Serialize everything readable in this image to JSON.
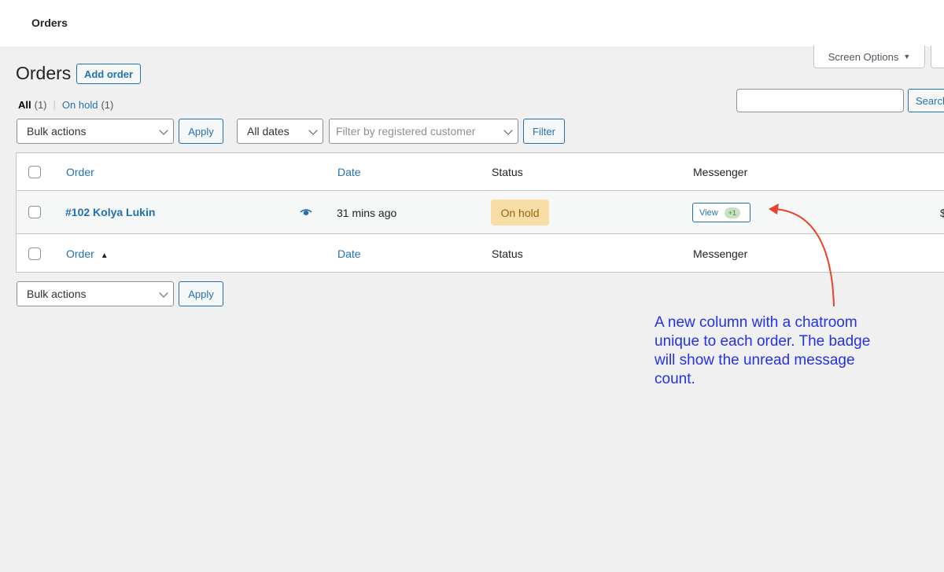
{
  "topbar": {
    "title": "Orders"
  },
  "screen_options": {
    "label": "Screen Options",
    "caret": "▼"
  },
  "page": {
    "title": "Orders",
    "add_button": "Add order"
  },
  "views": {
    "all_label": "All",
    "all_count": "(1)",
    "separator": "|",
    "on_hold_label": "On hold",
    "on_hold_count": "(1)"
  },
  "search": {
    "value": "",
    "button": "Search"
  },
  "filters": {
    "bulk_actions": "Bulk actions",
    "apply": "Apply",
    "dates": "All dates",
    "customer_placeholder": "Filter by registered customer",
    "filter": "Filter"
  },
  "table": {
    "columns": {
      "order": "Order",
      "date": "Date",
      "status": "Status",
      "messenger": "Messenger"
    },
    "rows": [
      {
        "order": "#102 Kolya Lukin",
        "date": "31 mins ago",
        "status": "On hold",
        "messenger_label": "View",
        "unread": "+1",
        "total_prefix": "$"
      }
    ],
    "sort_indicator": "▲"
  },
  "bottom": {
    "bulk_actions": "Bulk actions",
    "apply": "Apply"
  },
  "annotation": {
    "text": "A new column with a chatroom unique to each order. The badge will show the unread message count."
  },
  "colors": {
    "accent": "#2271b1",
    "annotation": "#2431e8",
    "arrow": "#e8432b",
    "status_on_hold_bg": "#f8dda7",
    "status_on_hold_text": "#94660c"
  },
  "icons": {
    "preview": "eye-icon",
    "dropdown": "chevron-down-icon",
    "caret": "caret-down-icon"
  }
}
